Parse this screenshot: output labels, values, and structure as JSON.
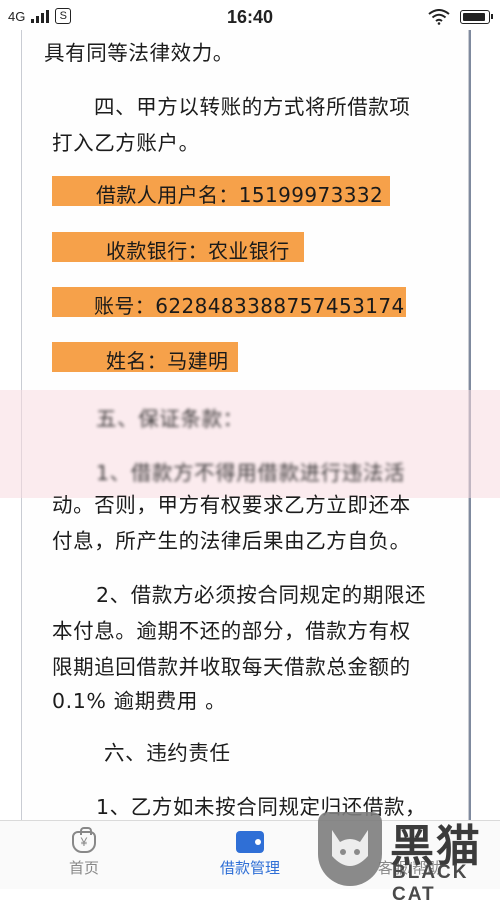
{
  "status_bar": {
    "network": "4G",
    "notification": "S",
    "time": "16:40"
  },
  "document": {
    "lines": [
      "具有同等法律效力。",
      "四、甲方以转账的方式将所借款项",
      "打入乙方账户。",
      "五、保证条款：",
      "1、借款方不得用借款进行违法活",
      "动。否则，甲方有权要求乙方立即还本",
      "付息，所产生的法律后果由乙方自负。",
      "2、借款方必须按合同规定的期限还",
      "本付息。逾期不还的部分，借款方有权",
      "限期追回借款并收取每天借款总金额的",
      "0.1% 逾期费用 。",
      "六、违约责任",
      "1、乙方如未按合同规定归还借款，"
    ],
    "highlights": [
      "借款人用户名：15199973332",
      "收款银行：农业银行",
      "账号：6228483388757453174",
      "姓名：马建明"
    ]
  },
  "bottom_nav": {
    "items": [
      {
        "label": "首页",
        "icon": "money-bag-icon",
        "active": false
      },
      {
        "label": "借款管理",
        "icon": "wallet-icon",
        "active": true
      },
      {
        "label": "客服/帮助",
        "icon": "help-icon",
        "active": false
      }
    ]
  },
  "watermark": {
    "cn": "黑猫",
    "en": "BLACK CAT"
  },
  "colors": {
    "highlight": "#f6a14a",
    "active_tab": "#2f6fd6",
    "inactive_tab": "#888888"
  }
}
